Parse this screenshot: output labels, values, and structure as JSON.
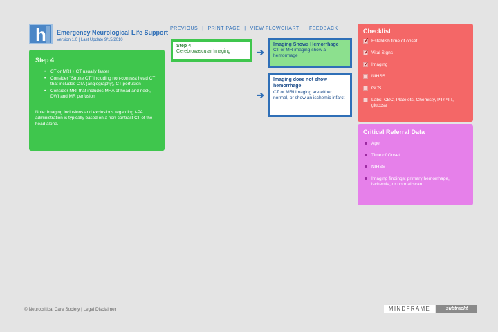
{
  "header": {
    "logo_letter": "h",
    "title": "Emergency Neurological Life Support",
    "version": "Version 1.0 | Last Update 9/15/2010"
  },
  "nav": {
    "items": [
      "PREVIOUS",
      "PRINT PAGE",
      "VIEW FLOWCHART",
      "FEEDBACK"
    ],
    "separator": "|"
  },
  "step_panel": {
    "heading": "Step 4",
    "bullets": [
      "CT or MRI + CT usually faster",
      "Consider \"Stroke CT\" including non-contrast head CT that includes CTA (angiography), CT perfusion",
      "Consider MRI that includes MRA of head and neck, DWI and MR perfusion"
    ],
    "note": "Note: imaging inclusions and exclusions regarding t-PA administration is typically based on a non-contrast CT of the head alone."
  },
  "flow": {
    "step_label": "Step 4",
    "step_title": "Cerebrovascular Imaging",
    "arrow": "➔",
    "option_a": {
      "title": "Imaging Shows Hemorrhage",
      "text": "CT or MR imaging show a hemorrhage"
    },
    "option_b": {
      "title": "Imaging does not show hemorrhage",
      "text": "CT or MRI imaging are either normal, or show an ischemic infarct"
    }
  },
  "checklist": {
    "title": "Checklist",
    "items": [
      {
        "label": "Establish time of onset",
        "checked": true
      },
      {
        "label": "Vital Signs",
        "checked": true
      },
      {
        "label": "Imaging",
        "checked": true
      },
      {
        "label": "NIHSS",
        "checked": false
      },
      {
        "label": "GCS",
        "checked": false
      },
      {
        "label": "Labs: CBC, Platelets, Chemisty, PT/PTT, glucose",
        "checked": false
      }
    ],
    "tick": "✓"
  },
  "critical": {
    "title": "Critical Referral Data",
    "items": [
      "Age",
      "Time of Onset",
      "NIHSS",
      "Imaging findings: primary hemorrhage, ischemia, or normal scan"
    ]
  },
  "footer": {
    "copyright": "© Neurocritical Care Society",
    "separator": "|",
    "disclaimer": "Legal Disclaimer",
    "brand_primary": "MINDFRAME",
    "brand_secondary": "subtrackt"
  },
  "colors": {
    "background": "#e4e4e4",
    "step_green": "#3fc64d",
    "flow_blue": "#2f6fb7",
    "option_a_fill": "#8ce08e",
    "checklist_red": "#f46767",
    "critical_pink": "#e680ea"
  }
}
